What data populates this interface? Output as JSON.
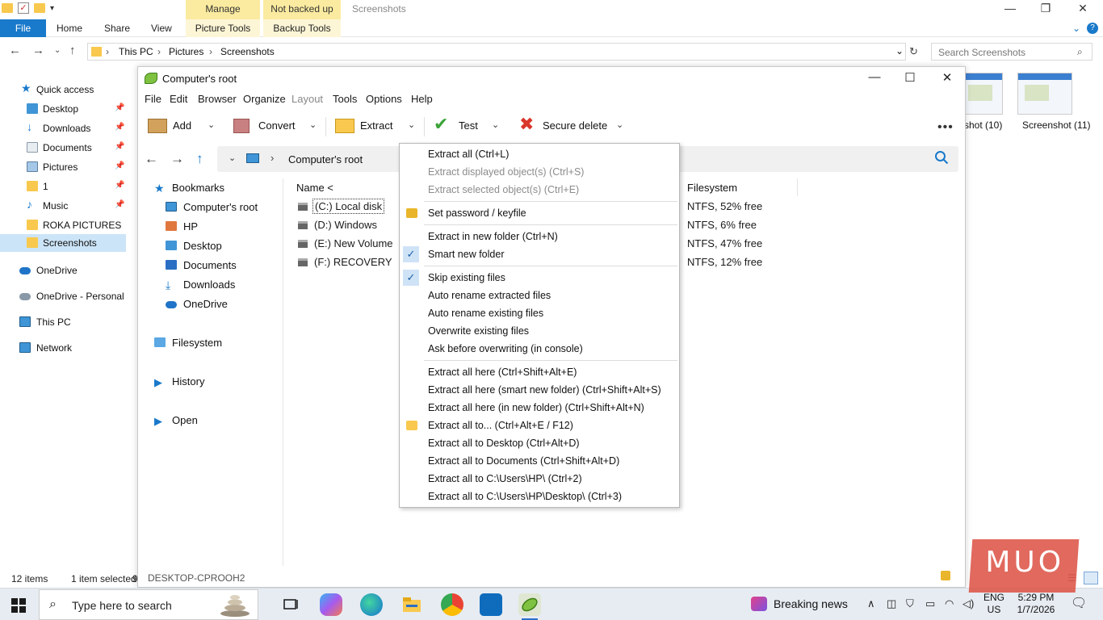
{
  "explorer": {
    "window_title": "Screenshots",
    "context_tabs": [
      "Manage",
      "Not backed up"
    ],
    "ribbon": {
      "file": "File",
      "home": "Home",
      "share": "Share",
      "view": "View",
      "picture_tools": "Picture Tools",
      "backup_tools": "Backup Tools"
    },
    "breadcrumb": [
      "This PC",
      "Pictures",
      "Screenshots"
    ],
    "search_placeholder": "Search Screenshots",
    "sidebar": [
      {
        "label": "Quick access",
        "icon": "star-icon"
      },
      {
        "label": "Desktop",
        "icon": "desktop-icon",
        "pinned": true
      },
      {
        "label": "Downloads",
        "icon": "download-icon",
        "pinned": true
      },
      {
        "label": "Documents",
        "icon": "documents-icon",
        "pinned": true
      },
      {
        "label": "Pictures",
        "icon": "pictures-icon",
        "pinned": true
      },
      {
        "label": "1",
        "icon": "folder-icon",
        "pinned": true
      },
      {
        "label": "Music",
        "icon": "music-icon",
        "pinned": true
      },
      {
        "label": "ROKA PICTURES",
        "icon": "folder-icon"
      },
      {
        "label": "Screenshots",
        "icon": "folder-icon",
        "selected": true
      },
      {
        "label": "OneDrive",
        "icon": "cloud-icon"
      },
      {
        "label": "OneDrive - Personal",
        "icon": "cloud-icon"
      },
      {
        "label": "This PC",
        "icon": "pc-icon"
      },
      {
        "label": "Network",
        "icon": "network-icon"
      }
    ],
    "thumbnails": [
      "shot (10)",
      "Screenshot (11)"
    ],
    "status": {
      "count": "12 items",
      "selected": "1 item selected",
      "trailing": "9"
    }
  },
  "peazip": {
    "title": "Computer's root",
    "menu": [
      "File",
      "Edit",
      "Browser",
      "Organize",
      "Layout",
      "Tools",
      "Options",
      "Help"
    ],
    "toolbar": {
      "add": "Add",
      "convert": "Convert",
      "extract": "Extract",
      "test": "Test",
      "secure_delete": "Secure delete"
    },
    "address": "Computer's root",
    "tree": [
      {
        "label": "Bookmarks",
        "icon": "star-icon"
      },
      {
        "label": "Computer's root",
        "icon": "pc-icon"
      },
      {
        "label": "HP",
        "icon": "home-icon"
      },
      {
        "label": "Desktop",
        "icon": "desktop-icon"
      },
      {
        "label": "Documents",
        "icon": "documents-icon"
      },
      {
        "label": "Downloads",
        "icon": "download-icon"
      },
      {
        "label": "OneDrive",
        "icon": "cloud-icon"
      },
      {
        "label": "Filesystem",
        "icon": "folder-icon"
      },
      {
        "label": "History",
        "icon": "play-icon"
      },
      {
        "label": "Open",
        "icon": "play-icon"
      }
    ],
    "columns": {
      "name": "Name <",
      "filesystem": "Filesystem"
    },
    "rows": [
      {
        "name": "(C:) Local disk",
        "fs": "NTFS, 52% free"
      },
      {
        "name": "(D:) Windows",
        "fs": "NTFS, 6% free"
      },
      {
        "name": "(E:) New Volume",
        "fs": "NTFS, 47% free"
      },
      {
        "name": "(F:) RECOVERY",
        "fs": "NTFS, 12% free"
      }
    ],
    "status": "DESKTOP-CPROOH2"
  },
  "extract_menu": [
    {
      "label": "Extract all (Ctrl+L)"
    },
    {
      "label": "Extract displayed object(s) (Ctrl+S)",
      "disabled": true
    },
    {
      "label": "Extract selected object(s) (Ctrl+E)",
      "disabled": true
    },
    {
      "sep": true
    },
    {
      "label": "Set password / keyfile",
      "icon": "lock-icon"
    },
    {
      "sep": true
    },
    {
      "label": "Extract in new folder (Ctrl+N)"
    },
    {
      "label": "Smart new folder",
      "checked": true
    },
    {
      "sep": true
    },
    {
      "label": "Skip existing files",
      "checked": true
    },
    {
      "label": "Auto rename extracted files"
    },
    {
      "label": "Auto rename existing files"
    },
    {
      "label": "Overwrite existing files"
    },
    {
      "label": "Ask before overwriting (in console)"
    },
    {
      "sep": true
    },
    {
      "label": "Extract all here (Ctrl+Shift+Alt+E)"
    },
    {
      "label": "Extract all here (smart new folder) (Ctrl+Shift+Alt+S)"
    },
    {
      "label": "Extract all here (in new folder) (Ctrl+Shift+Alt+N)"
    },
    {
      "label": "Extract all to... (Ctrl+Alt+E / F12)",
      "icon": "folder-icon"
    },
    {
      "label": "Extract all to Desktop (Ctrl+Alt+D)"
    },
    {
      "label": "Extract all to Documents (Ctrl+Shift+Alt+D)"
    },
    {
      "label": "Extract all to C:\\Users\\HP\\ (Ctrl+2)"
    },
    {
      "label": "Extract all to C:\\Users\\HP\\Desktop\\ (Ctrl+3)"
    }
  ],
  "taskbar": {
    "search_placeholder": "Type here to search",
    "news": "Breaking news",
    "lang": [
      "ENG",
      "US"
    ],
    "time": "5:29 PM",
    "date": "1/7/2026"
  },
  "watermark": "MUO"
}
